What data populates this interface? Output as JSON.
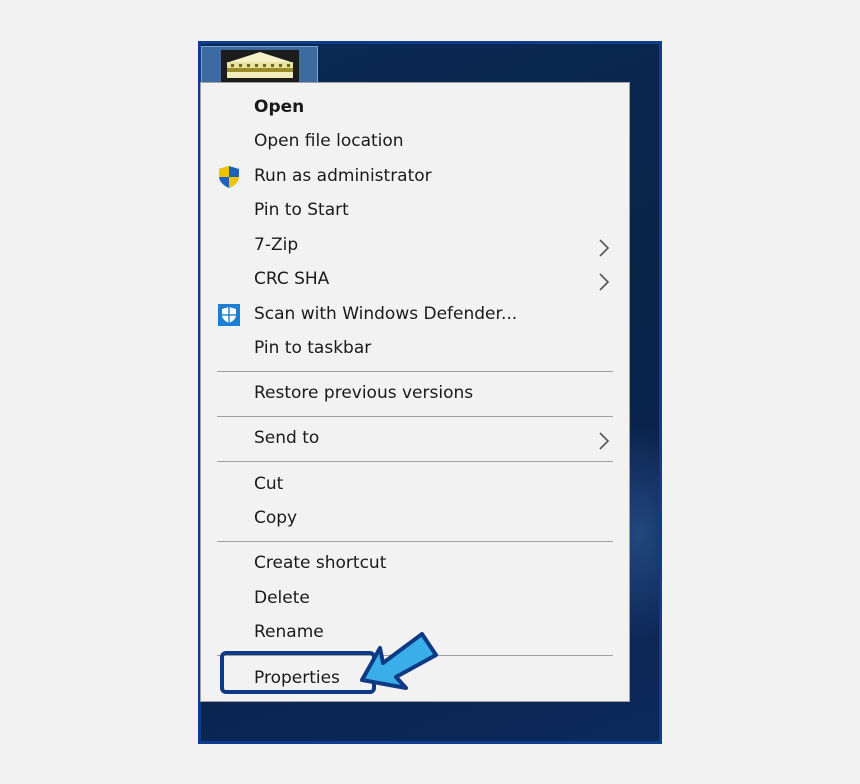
{
  "desktop": {
    "icon_name": "application-icon"
  },
  "context_menu": {
    "items": [
      {
        "label": "Open",
        "bold": true,
        "icon": null,
        "submenu": false
      },
      {
        "label": "Open file location",
        "icon": null,
        "submenu": false
      },
      {
        "label": "Run as administrator",
        "icon": "uac-shield-icon",
        "submenu": false
      },
      {
        "label": "Pin to Start",
        "icon": null,
        "submenu": false
      },
      {
        "label": "7-Zip",
        "icon": null,
        "submenu": true
      },
      {
        "label": "CRC SHA",
        "icon": null,
        "submenu": true
      },
      {
        "label": "Scan with Windows Defender...",
        "icon": "windows-defender-icon",
        "submenu": false
      },
      {
        "label": "Pin to taskbar",
        "icon": null,
        "submenu": false
      },
      {
        "label": "Restore previous versions",
        "icon": null,
        "submenu": false
      },
      {
        "label": "Send to",
        "icon": null,
        "submenu": true
      },
      {
        "label": "Cut",
        "icon": null,
        "submenu": false
      },
      {
        "label": "Copy",
        "icon": null,
        "submenu": false
      },
      {
        "label": "Create shortcut",
        "icon": null,
        "submenu": false
      },
      {
        "label": "Delete",
        "icon": null,
        "submenu": false
      },
      {
        "label": "Rename",
        "icon": null,
        "submenu": false
      },
      {
        "label": "Properties",
        "icon": null,
        "submenu": false,
        "highlighted": true
      }
    ]
  },
  "annotation": {
    "arrow_color": "#3aaee8",
    "outline_color": "#0e3a84"
  }
}
